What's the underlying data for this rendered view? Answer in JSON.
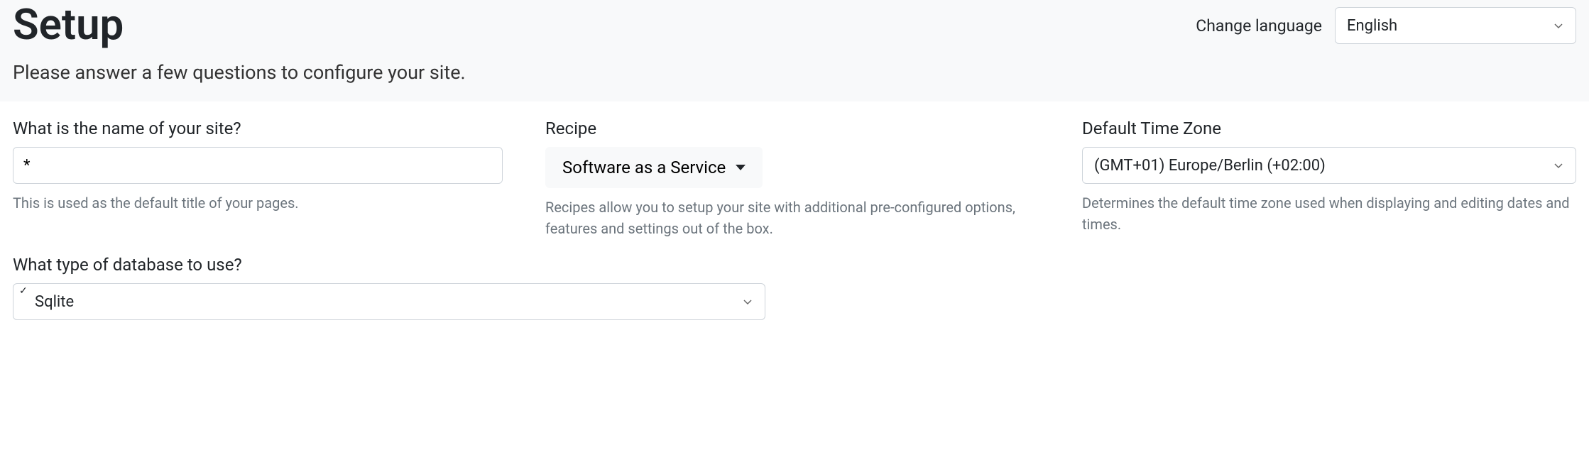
{
  "header": {
    "title": "Setup",
    "subtitle": "Please answer a few questions to configure your site.",
    "changeLanguageLabel": "Change language",
    "languageValue": "English"
  },
  "form": {
    "siteName": {
      "label": "What is the name of your site?",
      "value": "*",
      "help": "This is used as the default title of your pages."
    },
    "recipe": {
      "label": "Recipe",
      "value": "Software as a Service",
      "help": "Recipes allow you to setup your site with additional pre-configured options, features and settings out of the box."
    },
    "timezone": {
      "label": "Default Time Zone",
      "value": "(GMT+01) Europe/Berlin (+02:00)",
      "help": "Determines the default time zone used when displaying and editing dates and times."
    },
    "database": {
      "label": "What type of database to use?",
      "value": "Sqlite"
    }
  }
}
